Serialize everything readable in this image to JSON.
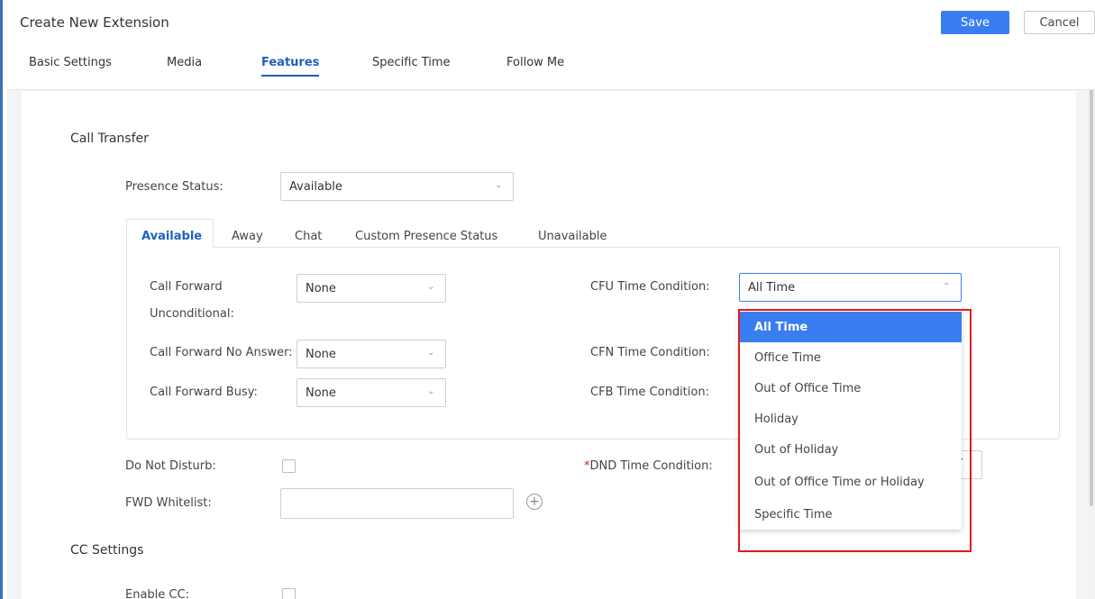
{
  "header": {
    "title": "Create New Extension",
    "save_label": "Save",
    "cancel_label": "Cancel"
  },
  "tabs": [
    {
      "label": "Basic Settings",
      "active": false
    },
    {
      "label": "Media",
      "active": false
    },
    {
      "label": "Features",
      "active": true
    },
    {
      "label": "Specific Time",
      "active": false
    },
    {
      "label": "Follow Me",
      "active": false
    }
  ],
  "call_transfer": {
    "section_title": "Call Transfer",
    "presence_status_label": "Presence Status:",
    "presence_status_value": "Available",
    "subtabs": [
      {
        "label": "Available",
        "active": true
      },
      {
        "label": "Away",
        "active": false
      },
      {
        "label": "Chat",
        "active": false
      },
      {
        "label": "Custom Presence Status",
        "active": false
      },
      {
        "label": "Unavailable",
        "active": false
      }
    ],
    "cfu_label_line1": "Call Forward",
    "cfu_label_line2": "Unconditional:",
    "cfu_value": "None",
    "cfn_label": "Call Forward No Answer:",
    "cfn_value": "None",
    "cfb_label": "Call Forward Busy:",
    "cfb_value": "None",
    "cfu_time_label": "CFU Time Condition:",
    "cfu_time_value": "All Time",
    "cfn_time_label": "CFN Time Condition:",
    "cfb_time_label": "CFB Time Condition:"
  },
  "dnd": {
    "label": "Do Not Disturb:",
    "time_label_required": "*",
    "time_label": "DND Time Condition:",
    "fwd_whitelist_label": "FWD Whitelist:"
  },
  "cc_settings": {
    "section_title": "CC Settings",
    "enable_cc_label": "Enable CC:"
  },
  "time_condition_dropdown": {
    "options": [
      "All Time",
      "Office Time",
      "Out of Office Time",
      "Holiday",
      "Out of Holiday",
      "Out of Office Time or Holiday",
      "Specific Time"
    ],
    "selected": "All Time"
  },
  "colors": {
    "accent": "#3a7df0",
    "active_tab": "#1f5fbf",
    "highlight": "#e01b1b"
  }
}
